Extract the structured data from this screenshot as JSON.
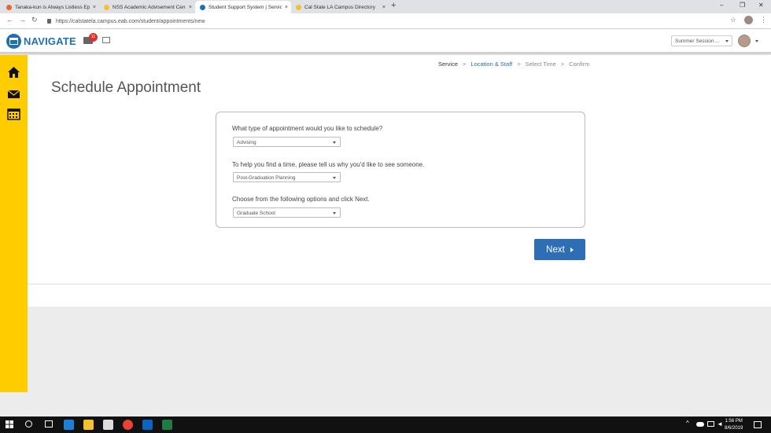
{
  "browser": {
    "tabs": [
      {
        "label": "Tanaka-kun is Always Listless Epi",
        "active": false,
        "favicon_color": "#e8672b"
      },
      {
        "label": "NSS Academic Advisement Cent",
        "active": false,
        "favicon_color": "#f2c12e"
      },
      {
        "label": "Student Support System | Service",
        "active": true,
        "favicon_color": "#1f6fb6"
      },
      {
        "label": "Cal State LA Campus Directory",
        "active": false,
        "favicon_color": "#f2c12e"
      }
    ],
    "close_glyph": "×",
    "newtab_glyph": "+",
    "window_controls": [
      "–",
      "❐",
      "✕"
    ],
    "url": "https://calstatela.campus.eab.com/student/appointments/new"
  },
  "header": {
    "logo_text": "NAVIGATE",
    "notification_count": "11",
    "term_select": "Summer Session ..."
  },
  "sidebar": {
    "items": [
      {
        "icon": "home-icon"
      },
      {
        "icon": "mail-icon"
      },
      {
        "icon": "calendar-icon"
      }
    ]
  },
  "steps": {
    "items": [
      {
        "label": "Service",
        "state": "current"
      },
      {
        "label": "Location & Staff",
        "state": "link"
      },
      {
        "label": "Select Time",
        "state": "future"
      },
      {
        "label": "Confirm",
        "state": "future"
      }
    ],
    "separator": ">"
  },
  "page": {
    "title": "Schedule Appointment"
  },
  "form": {
    "q1": "What type of appointment would you like to schedule?",
    "q1_value": "Advising",
    "q2": "To help you find a time, please tell us why you'd like to see someone.",
    "q2_value": "Post-Graduation Planning",
    "q3": "Choose from the following options and click Next.",
    "q3_value": "Graduate School"
  },
  "actions": {
    "next_label": "Next"
  },
  "taskbar": {
    "time": "1:56 PM",
    "date": "8/6/2019"
  },
  "colors": {
    "brand_blue": "#2d6eb5",
    "sidebar_yellow": "#ffcc00",
    "badge_red": "#d9322d"
  }
}
